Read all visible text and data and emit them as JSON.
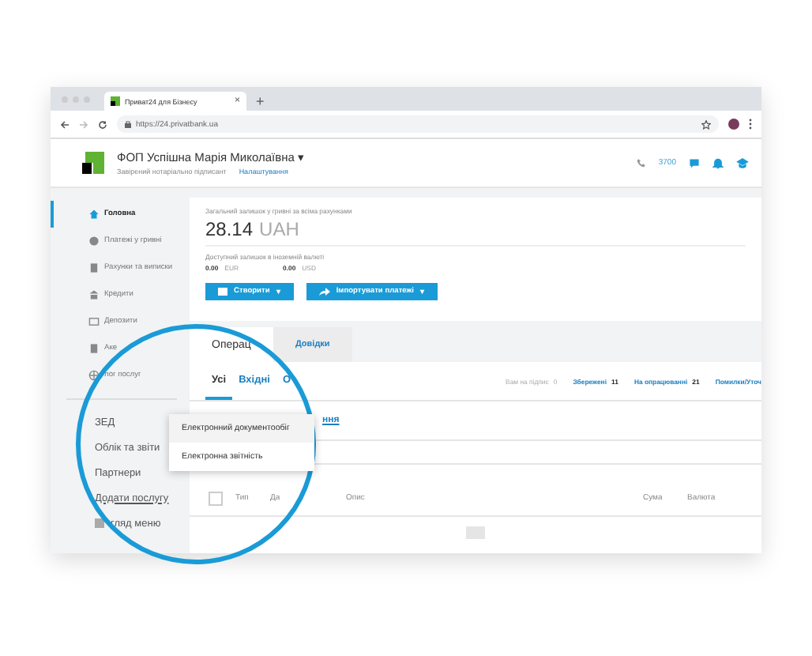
{
  "browser": {
    "tab_title": "Приват24 для Бізнесу",
    "tab_close": "×",
    "new_tab": "+",
    "url": "https://24.privatbank.ua"
  },
  "header": {
    "name": "ФОП Успішна Марія Миколаївна",
    "caret": "▾",
    "role": "Завірений нотаріально підписант",
    "settings": "Налаштування",
    "phone": "3700"
  },
  "sidebar": {
    "items": [
      {
        "label": "Головна",
        "selected": true
      },
      {
        "label": "Платежі у гривні",
        "selected": false
      },
      {
        "label": "Рахунки та виписки",
        "selected": false
      },
      {
        "label": "Кредити",
        "selected": false
      },
      {
        "label": "Депозити",
        "selected": false
      },
      {
        "label": "Аке",
        "selected": false
      },
      {
        "label": "лог послуг",
        "selected": false
      }
    ],
    "more_items": [
      {
        "label": "ЗЕД",
        "kind": "item"
      },
      {
        "label": "Облік та звіти",
        "kind": "item"
      },
      {
        "label": "Партнери",
        "kind": "item"
      },
      {
        "label": "Додати послугу",
        "kind": "link"
      },
      {
        "label": "гляд меню",
        "kind": "icon-item"
      }
    ]
  },
  "balance": {
    "label": "Загальний залишок у гривні за всіма рахунками",
    "amount": "28.14",
    "currency": "UAH",
    "foreign_label": "Доступний залишок в іноземній валюті",
    "foreign": [
      {
        "amount": "0.00",
        "currency": "EUR"
      },
      {
        "amount": "0.00",
        "currency": "USD"
      }
    ]
  },
  "actions": [
    {
      "label": "Створити",
      "caret": "▾",
      "kind": "create"
    },
    {
      "label": "Імпортувати платежі",
      "caret": "▾",
      "kind": "import"
    }
  ],
  "tabs": [
    {
      "label": "Операц",
      "selected": true
    },
    {
      "label": "Довідки",
      "selected": false
    }
  ],
  "subtabs": [
    {
      "label": "Усі",
      "selected": true
    },
    {
      "label": "Вхідні",
      "selected": false
    },
    {
      "label": "О",
      "selected": false
    }
  ],
  "counters": [
    {
      "label": "Вам на підпис",
      "count": "0",
      "disabled": true
    },
    {
      "label": "Збережені",
      "count": "11",
      "disabled": false
    },
    {
      "label": "На опрацюванні",
      "count": "21",
      "disabled": false
    },
    {
      "label": "Помилки/Уточ",
      "disabled": false
    }
  ],
  "link": "ння",
  "menu": {
    "items": [
      {
        "label": "Електронний документообіг",
        "selected": true
      },
      {
        "label": "Електронна звітність",
        "selected": false
      }
    ]
  },
  "table": {
    "select_all_checked": false,
    "columns": [
      "Тип",
      "Да",
      "Опис",
      "Сума",
      "Валюта"
    ]
  }
}
